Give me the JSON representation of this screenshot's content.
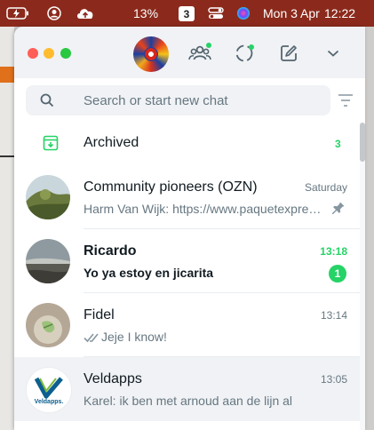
{
  "menubar": {
    "battery_icon": "battery-charging-icon",
    "user_icon": "user-circle-icon",
    "cloud_icon": "cloud-upload-icon",
    "percent": "13%",
    "badge": "3",
    "toggle_icon": "control-center-icon",
    "siri_icon": "siri-icon",
    "date": "Mon 3 Apr",
    "time": "12:22"
  },
  "header": {
    "communities_icon": "communities-icon",
    "status_icon": "status-icon",
    "new_chat_icon": "new-chat-icon",
    "menu_icon": "chevron-down-icon"
  },
  "search": {
    "placeholder": "Search or start new chat"
  },
  "archived": {
    "label": "Archived",
    "count": "3"
  },
  "chats": [
    {
      "name": "Community pioneers (OZN)",
      "time": "Saturday",
      "message": "Harm Van Wijk: https://www.paquetexpre…",
      "pinned": true
    },
    {
      "name": "Ricardo",
      "time": "13:18",
      "message": "Yo ya estoy en jicarita",
      "unread": "1"
    },
    {
      "name": "Fidel",
      "time": "13:14",
      "message": "Jeje I know!",
      "read_ticks": true
    },
    {
      "name": "Veldapps",
      "time": "13:05",
      "message": "Karel: ik ben met arnoud aan de lijn al",
      "avatar_text": "Veldapps."
    }
  ],
  "colors": {
    "accent_green": "#25d366",
    "menubar": "#8b2a1c"
  }
}
